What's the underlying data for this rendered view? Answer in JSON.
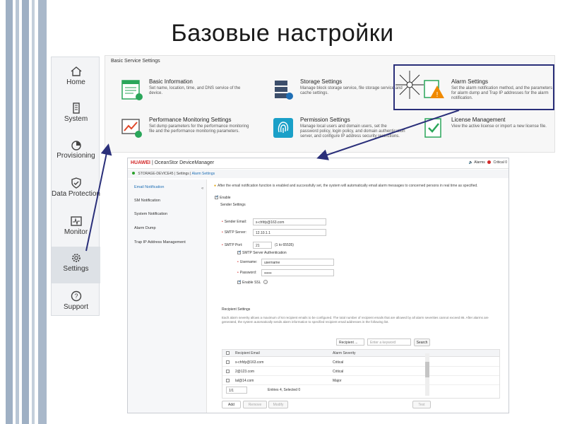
{
  "slide": {
    "title": "Базовые настройки"
  },
  "sidenav": {
    "items": [
      {
        "label": "Home",
        "icon": "home-icon"
      },
      {
        "label": "System",
        "icon": "system-icon"
      },
      {
        "label": "Provisioning",
        "icon": "provisioning-icon"
      },
      {
        "label": "Data Protection",
        "icon": "shield-icon"
      },
      {
        "label": "Monitor",
        "icon": "monitor-icon"
      },
      {
        "label": "Settings",
        "icon": "gear-icon"
      },
      {
        "label": "Support",
        "icon": "help-icon"
      }
    ]
  },
  "services": {
    "header": "Basic Service Settings",
    "items": [
      {
        "title": "Basic Information",
        "desc": "Set name, location, time, and DNS service of the device."
      },
      {
        "title": "Storage Settings",
        "desc": "Manage block storage service, file storage service and cache settings."
      },
      {
        "title": "Alarm Settings",
        "desc": "Set the alarm notification method, and the parameters for alarm dump and Trap IP addresses for the alarm notification."
      },
      {
        "title": "Performance Monitoring Settings",
        "desc": "Set dump parameters for the performance monitoring file and the performance monitoring parameters."
      },
      {
        "title": "Permission Settings",
        "desc": "Manage local users and domain users, set the password policy, login policy, and domain authentication server, and configure IP address security restrictions."
      },
      {
        "title": "License Management",
        "desc": "View the active license or import a new license file."
      }
    ]
  },
  "dm": {
    "brand": "HUAWEI",
    "title": "| OceanStor DeviceManager",
    "alarms_label": "Alarms",
    "critical_label": "Critical 0",
    "breadcrumb": {
      "device": "STORAGE-DEVICE45",
      "sep1": "|",
      "settings": "Settings",
      "sep2": "|",
      "current": "Alarm Settings"
    },
    "menu": [
      "Email Notification",
      "SM Notification",
      "System Notification",
      "Alarm Dump",
      "Trap IP Address Management"
    ],
    "info": "After the email notification function is enabled and successfully set, the system will automatically email alarm messages to concerned persons in real time as specified.",
    "enable_label": "Enable",
    "sender_section": "Sender Settings",
    "sender_email_label": "Sender Email:",
    "sender_email_value": "s-chfdy@163.com",
    "smtp_server_label": "SMTP Server:",
    "smtp_server_value": "12.10.1.1",
    "smtp_port_label": "SMTP Port:",
    "smtp_port_value": "21",
    "smtp_port_range": "(1 to 65535)",
    "smtp_auth_label": "SMTP Server Authentication",
    "username_label": "Username:",
    "username_value": "username",
    "password_label": "Password:",
    "password_value": "••••••",
    "ssl_label": "Enable SSL",
    "recipient_section": "Recipient Settings",
    "recipient_desc": "Each alarm severity allows a maximum of 64 recipient emails to be configured. The total number of recipient emails that are allowed by all alarm severities cannot exceed 86. After alarms are generated, the system automatically sends alarm information to specified recipient email addresses in the following list.",
    "filter_select": "Recipient ...",
    "search_placeholder": "Enter a keyword",
    "search_button": "Search",
    "table_headers": [
      "Recipient Email",
      "Alarm Severity"
    ],
    "rows": [
      {
        "email": "s-chfdy@163.com",
        "severity": "Critical"
      },
      {
        "email": "2@123.com",
        "severity": "Critical"
      },
      {
        "email": "lal@14.com",
        "severity": "Major"
      }
    ],
    "pager_value": "1/1",
    "entries_text": "Entries 4, Selected 0",
    "buttons": {
      "add": "Add",
      "remove": "Remove",
      "modify": "Modify",
      "test": "Test"
    }
  }
}
